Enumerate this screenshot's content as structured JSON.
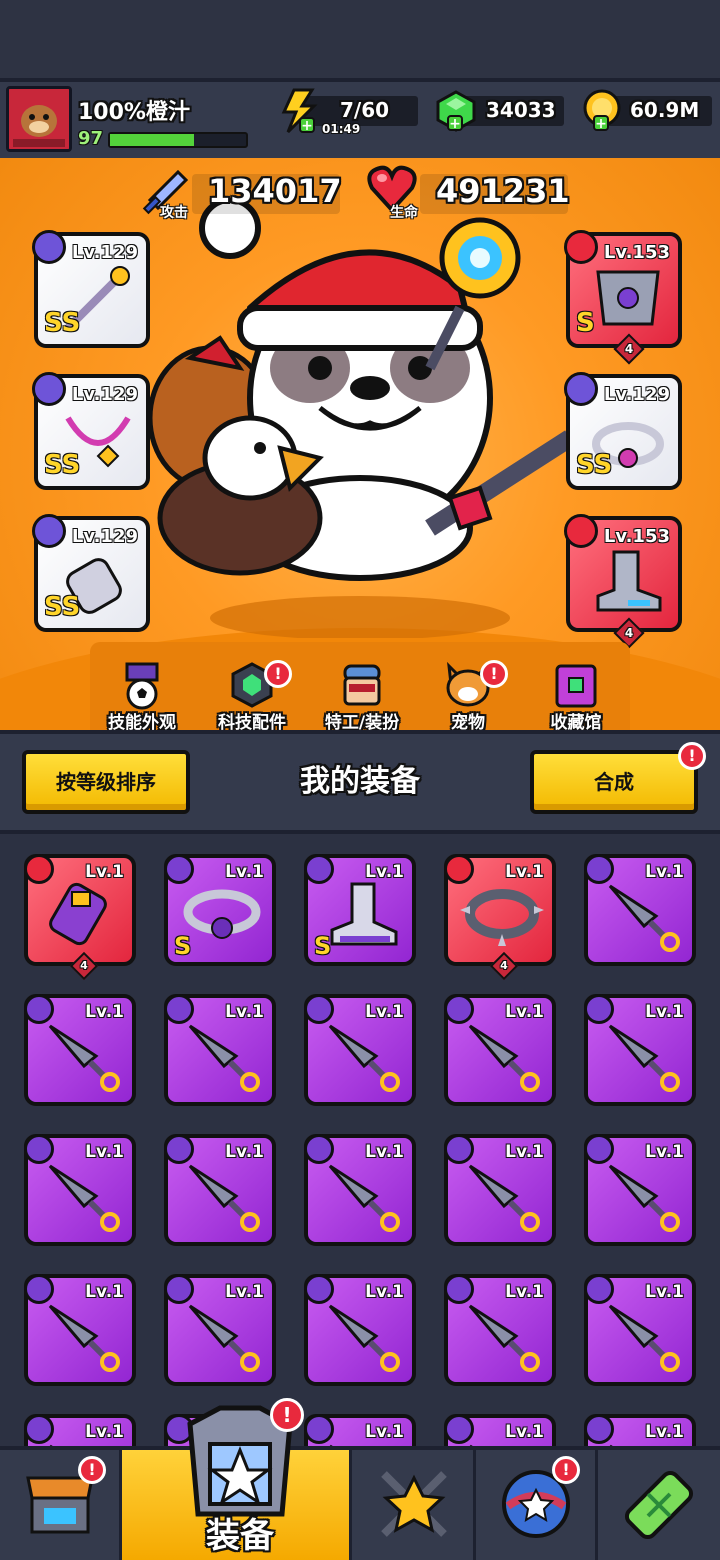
{
  "player": {
    "name": "100%橙汁",
    "level": "97",
    "xp_fraction": 0.62
  },
  "resources": {
    "energy": "7/60",
    "energy_timer": "01:49",
    "gems": "34033",
    "coins": "60.9M"
  },
  "stats": {
    "attack_label": "攻击",
    "attack_value": "134017",
    "hp_label": "生命",
    "hp_value": "491231"
  },
  "equipped": {
    "left": [
      {
        "level": "Lv.129",
        "grade": "SS"
      },
      {
        "level": "Lv.129",
        "grade": "SS"
      },
      {
        "level": "Lv.129",
        "grade": "SS"
      }
    ],
    "right": [
      {
        "level": "Lv.153",
        "grade": "S",
        "stars": "4"
      },
      {
        "level": "Lv.129",
        "grade": "SS"
      },
      {
        "level": "Lv.153",
        "stars": "4"
      }
    ]
  },
  "menu": [
    {
      "label": "技能外观"
    },
    {
      "label": "科技配件",
      "alert": "!"
    },
    {
      "label": "特工/装扮"
    },
    {
      "label": "宠物",
      "alert": "!"
    },
    {
      "label": "收藏馆"
    }
  ],
  "equipment_panel": {
    "sort_button": "按等级排序",
    "title": "我的装备",
    "merge_button": "合成",
    "merge_alert": "!"
  },
  "inventory_row1": [
    {
      "level": "Lv.1",
      "stars": "4"
    },
    {
      "level": "Lv.1",
      "grade": "S"
    },
    {
      "level": "Lv.1",
      "grade": "S"
    },
    {
      "level": "Lv.1",
      "stars": "4"
    },
    {
      "level": "Lv.1"
    }
  ],
  "inventory_item_level": "Lv.1",
  "bottom_nav": {
    "active_label": "装备",
    "alert": "!"
  },
  "colors": {
    "stage_orange": "#ff9a24",
    "epic_purple": "#a83be0",
    "legend_red": "#e3263e",
    "button_yellow": "#ffd23a",
    "panel_dark": "#343a4c"
  }
}
